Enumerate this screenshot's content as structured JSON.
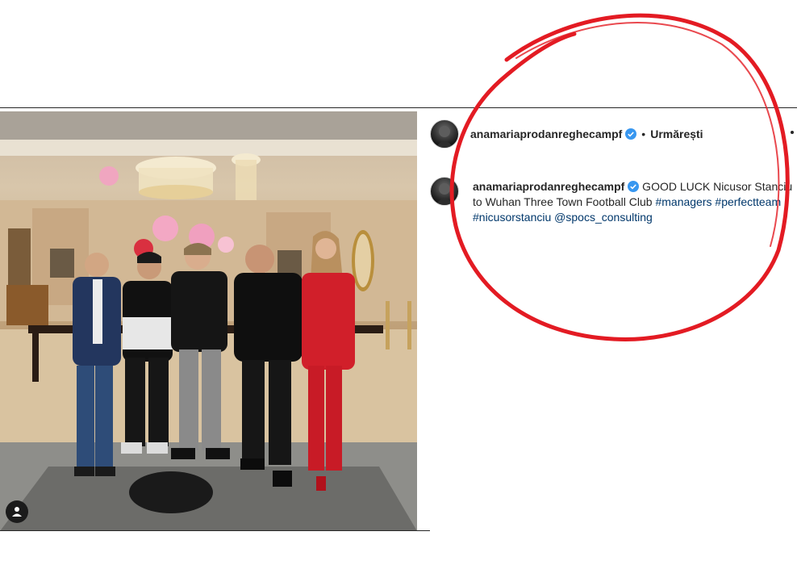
{
  "post": {
    "username": "anamariaprodanreghecampf",
    "follow_status": "Urmărești",
    "separator": "•"
  },
  "caption": {
    "username": "anamariaprodanreghecampf",
    "text_part1": " GOOD LUCK Nicusor Stanciu to Wuhan Three Town Football Club ",
    "hashtag1": "#managers",
    "hashtag2": "#perfectteam",
    "hashtag3": "#nicusorstanciu",
    "mention": "@spocs_consulting"
  },
  "colors": {
    "verified_badge": "#3897f0",
    "link": "#00376b",
    "annotation_circle": "#e31b23"
  },
  "icons": {
    "user_tag": "person-icon",
    "verified": "verified-badge-icon"
  }
}
